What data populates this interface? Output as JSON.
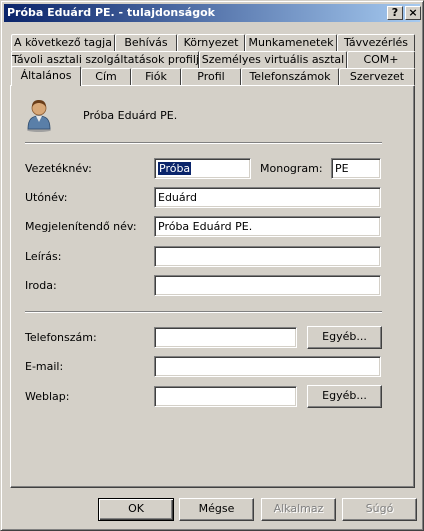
{
  "window": {
    "title": "Próba Eduárd PE. - tulajdonságok",
    "help_label": "?",
    "close_label": "×"
  },
  "tabs": {
    "row1": [
      "A következő tagja",
      "Behívás",
      "Környezet",
      "Munkamenetek",
      "Távvezérlés"
    ],
    "row2": [
      "Távoli asztali szolgáltatások profilja",
      "Személyes virtuális asztal",
      "COM+"
    ],
    "row3": [
      "Általános",
      "Cím",
      "Fiók",
      "Profil",
      "Telefonszámok",
      "Szervezet"
    ],
    "active": "Általános"
  },
  "header": {
    "icon": "user-icon",
    "display_name": "Próba Eduárd PE."
  },
  "form": {
    "last_name_label": "Vezetéknév:",
    "last_name_value": "Próba",
    "initials_label": "Monogram:",
    "initials_value": "PE",
    "first_name_label": "Utónév:",
    "first_name_value": "Eduárd",
    "display_name_label": "Megjelenítendő név:",
    "display_name_value": "Próba Eduárd PE.",
    "description_label": "Leírás:",
    "description_value": "",
    "office_label": "Iroda:",
    "office_value": "",
    "phone_label": "Telefonszám:",
    "phone_value": "",
    "phone_other_label": "Egyéb...",
    "email_label": "E-mail:",
    "email_value": "",
    "web_label": "Weblap:",
    "web_value": "",
    "web_other_label": "Egyéb..."
  },
  "footer": {
    "ok": "OK",
    "cancel": "Mégse",
    "apply": "Alkalmaz",
    "help": "Súgó"
  }
}
